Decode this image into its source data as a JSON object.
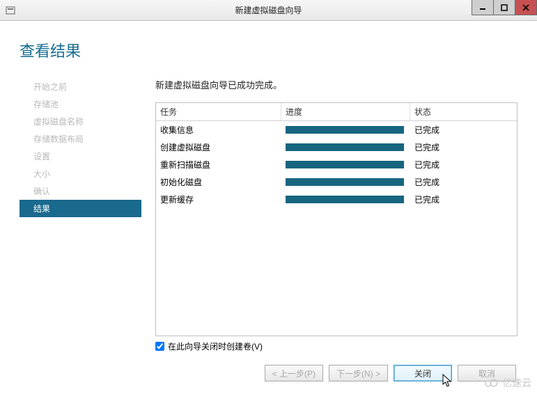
{
  "window": {
    "title": "新建虚拟磁盘向导"
  },
  "page_title": "查看结果",
  "sidebar": {
    "items": [
      {
        "label": "开始之前"
      },
      {
        "label": "存储池"
      },
      {
        "label": "虚拟磁盘名称"
      },
      {
        "label": "存储数据布局"
      },
      {
        "label": "设置"
      },
      {
        "label": "大小"
      },
      {
        "label": "确认"
      },
      {
        "label": "结果"
      }
    ],
    "active_index": 7
  },
  "main": {
    "status": "新建虚拟磁盘向导已成功完成。",
    "columns": {
      "task": "任务",
      "progress": "进度",
      "status": "状态"
    },
    "rows": [
      {
        "task": "收集信息",
        "progress": 100,
        "status": "已完成"
      },
      {
        "task": "创建虚拟磁盘",
        "progress": 100,
        "status": "已完成"
      },
      {
        "task": "重新扫描磁盘",
        "progress": 100,
        "status": "已完成"
      },
      {
        "task": "初始化磁盘",
        "progress": 100,
        "status": "已完成"
      },
      {
        "task": "更新缓存",
        "progress": 100,
        "status": "已完成"
      }
    ],
    "checkbox": {
      "checked": true,
      "label": "在此向导关闭时创建卷(V)"
    }
  },
  "footer": {
    "prev": "< 上一步(P)",
    "next": "下一步(N) >",
    "close": "关闭",
    "cancel": "取消"
  },
  "watermark": "亿速云"
}
